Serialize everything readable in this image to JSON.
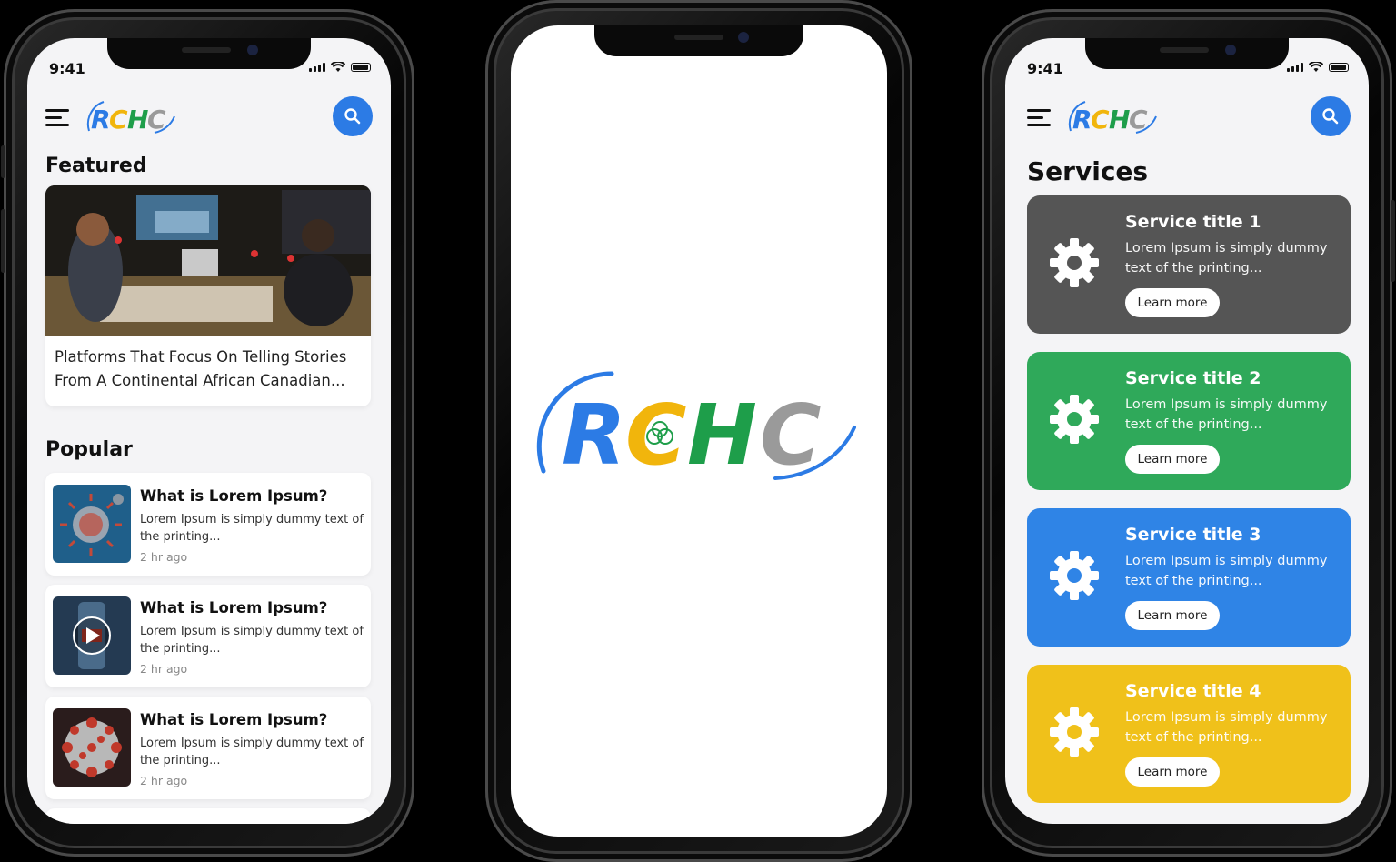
{
  "status": {
    "time": "9:41"
  },
  "brand": {
    "logo_letters": [
      "R",
      "C",
      "H",
      "C"
    ],
    "colors": {
      "blue": "#2c7be5",
      "yellow": "#f1b50c",
      "green": "#1e9e4a",
      "gray": "#9a9a9a"
    }
  },
  "left_phone": {
    "featured_heading": "Featured",
    "featured_card": {
      "text": "Platforms That Focus On Telling Stories From A Continental African Canadian..."
    },
    "popular_heading": "Popular",
    "popular_items": [
      {
        "title": "What is Lorem Ipsum?",
        "desc": "Lorem Ipsum is simply dummy text of the printing...",
        "time": "2 hr ago"
      },
      {
        "title": "What is Lorem Ipsum?",
        "desc": "Lorem Ipsum is simply dummy text of the printing...",
        "time": "2 hr ago"
      },
      {
        "title": "What is Lorem Ipsum?",
        "desc": "Lorem Ipsum is simply dummy text of the printing...",
        "time": "2 hr ago"
      }
    ]
  },
  "right_phone": {
    "services_heading": "Services",
    "services": [
      {
        "title": "Service title 1",
        "desc": "Lorem Ipsum is simply dummy text of the printing...",
        "button": "Learn more",
        "color": "#555555"
      },
      {
        "title": "Service title 2",
        "desc": "Lorem Ipsum is simply dummy text of the printing...",
        "button": "Learn more",
        "color": "#2fa95a"
      },
      {
        "title": "Service title 3",
        "desc": "Lorem Ipsum is simply dummy text of the printing...",
        "button": "Learn more",
        "color": "#2f84e6"
      },
      {
        "title": "Service title 4",
        "desc": "Lorem Ipsum is simply dummy text of the printing...",
        "button": "Learn more",
        "color": "#f0c11a"
      }
    ]
  }
}
